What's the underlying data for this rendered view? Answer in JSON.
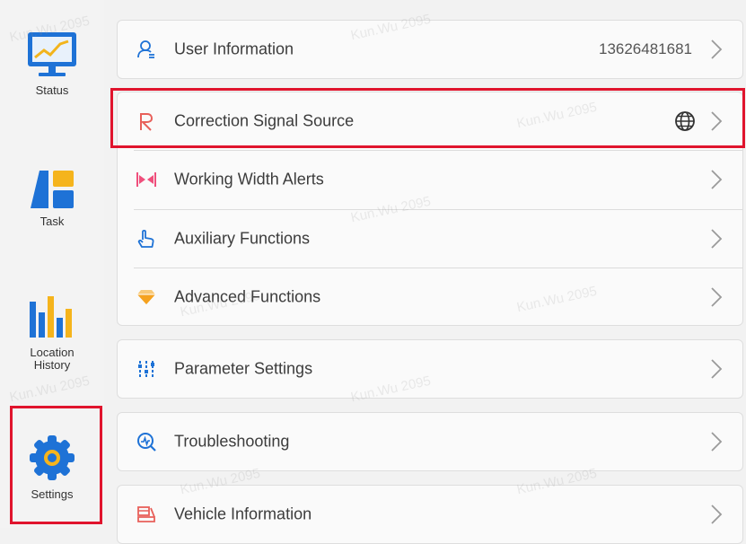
{
  "sidebar": {
    "items": [
      {
        "label": "Status",
        "icon": "monitor-chart-icon"
      },
      {
        "label": "Task",
        "icon": "task-blocks-icon"
      },
      {
        "label": "Location\nHistory",
        "icon": "bar-chart-icon"
      },
      {
        "label": "Settings",
        "icon": "gear-icon"
      }
    ]
  },
  "menu": {
    "user_information": {
      "label": "User Information",
      "value": "13626481681",
      "icon": "user-icon"
    },
    "correction_signal_source": {
      "label": "Correction Signal Source",
      "icon": "signal-r-icon",
      "trailing_icon": "globe-icon"
    },
    "working_width_alerts": {
      "label": "Working Width Alerts",
      "icon": "width-arrows-icon"
    },
    "auxiliary_functions": {
      "label": "Auxiliary Functions",
      "icon": "hand-pointer-icon"
    },
    "advanced_functions": {
      "label": "Advanced Functions",
      "icon": "diamond-icon"
    },
    "parameter_settings": {
      "label": "Parameter Settings",
      "icon": "sliders-icon"
    },
    "troubleshooting": {
      "label": "Troubleshooting",
      "icon": "magnifier-pulse-icon"
    },
    "vehicle_information": {
      "label": "Vehicle Information",
      "icon": "vehicle-icon"
    }
  },
  "watermark_text": "Kun.Wu 2095",
  "colors": {
    "accent_blue": "#1e72d6",
    "highlight_red": "#e0142d",
    "correction_red": "#e8605a",
    "width_pink": "#ef4f7c",
    "diamond_orange": "#f5a21f"
  }
}
